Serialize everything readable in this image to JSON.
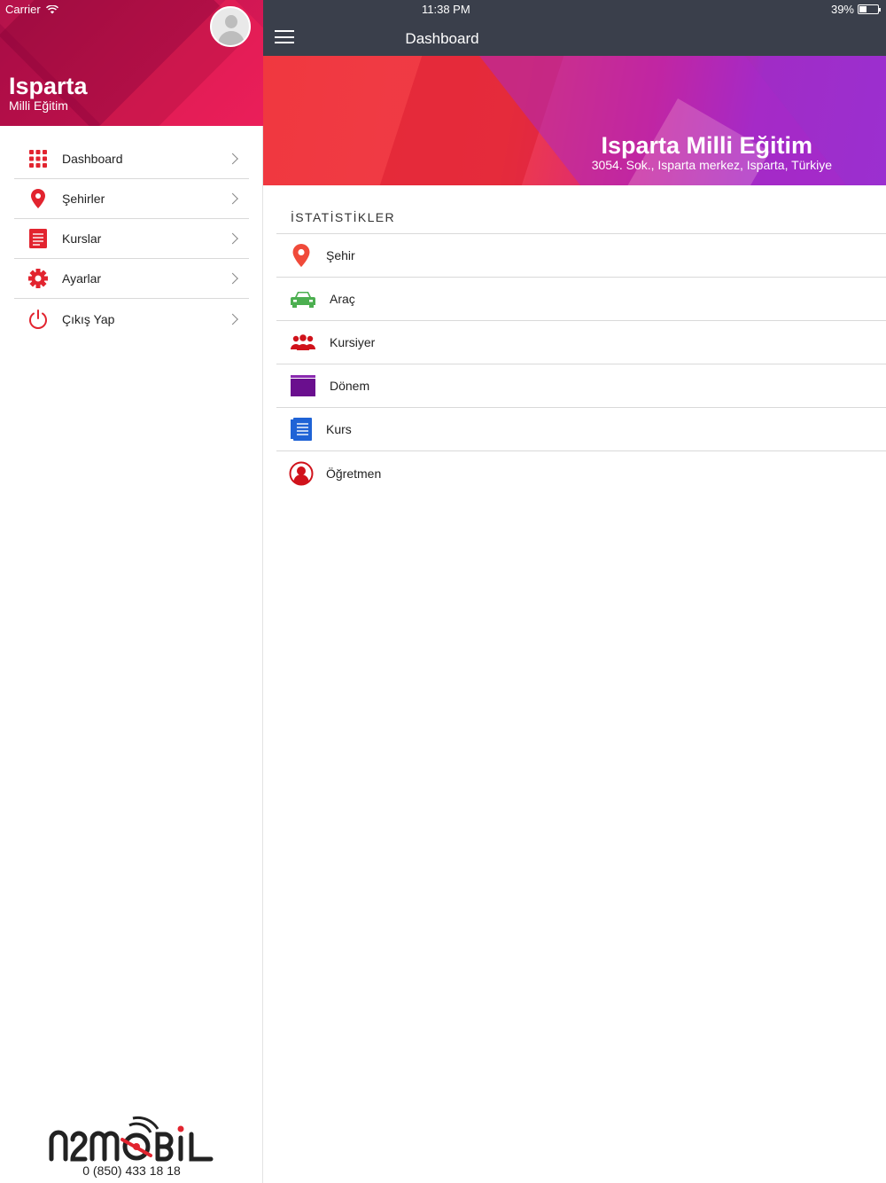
{
  "status_bar": {
    "carrier": "Carrier",
    "time": "11:38 PM",
    "battery": "39%",
    "battery_level": 0.39
  },
  "sidebar": {
    "title": "Isparta",
    "subtitle": "Milli Eğitim",
    "items": [
      {
        "label": "Dashboard",
        "icon": "grid-icon",
        "color": "#e2242f"
      },
      {
        "label": "Şehirler",
        "icon": "location-pin-icon",
        "color": "#e2242f"
      },
      {
        "label": "Kurslar",
        "icon": "document-icon",
        "color": "#e2242f"
      },
      {
        "label": "Ayarlar",
        "icon": "gear-icon",
        "color": "#e2242f"
      },
      {
        "label": "Çıkış Yap",
        "icon": "power-icon",
        "color": "#e2242f"
      }
    ],
    "brand": {
      "logo_text": "n2MOBIL",
      "phone": "0 (850) 433 18 18"
    }
  },
  "header": {
    "title": "Dashboard"
  },
  "banner": {
    "title": "Isparta Milli Eğitim",
    "address": "3054. Sok., Isparta merkez, Isparta, Türkiye"
  },
  "stats": {
    "header": "İSTATİSTİKLER",
    "items": [
      {
        "label": "Şehir",
        "icon": "location-pin-icon",
        "color": "#f04a3a"
      },
      {
        "label": "Araç",
        "icon": "car-icon",
        "color": "#4caf50"
      },
      {
        "label": "Kursiyer",
        "icon": "users-icon",
        "color": "#d0121b"
      },
      {
        "label": "Dönem",
        "icon": "calendar-block-icon",
        "color": "#6a0f8e"
      },
      {
        "label": "Kurs",
        "icon": "document-icon",
        "color": "#1f63d6"
      },
      {
        "label": "Öğretmen",
        "icon": "teacher-icon",
        "color": "#d0121b"
      }
    ]
  },
  "colors": {
    "accent": "#e2242f",
    "navbar": "#3a3f4b"
  }
}
